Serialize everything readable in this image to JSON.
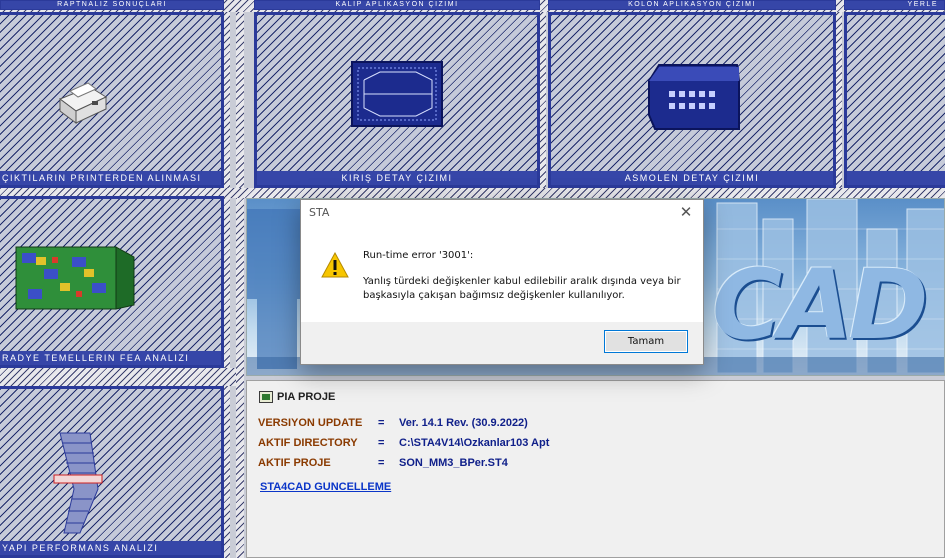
{
  "tiles": {
    "top_captions": [
      "RAPTNALIZ SONUÇLARI",
      "KALIP APLIKASYON ÇIZIMI",
      "KOLON APLIKASYON ÇIZIMI",
      "YERLE"
    ],
    "printer": {
      "caption": "ÇIKTILARIN PRINTERDEN ALINMASI"
    },
    "beam_detail": {
      "caption": "KIRIŞ DETAY ÇIZIMI"
    },
    "column_detail": {
      "caption": "ASMOLEN DETAY ÇIZIMI"
    },
    "raft_fea": {
      "caption": "RADYE TEMELLERIN FEA ANALIZI"
    },
    "performance": {
      "caption": "YAPI PERFORMANS ANALIZI"
    }
  },
  "banner": {
    "logo_text": "CAD"
  },
  "info": {
    "title": "PIA PROJE",
    "rows": [
      {
        "label": "VERSIYON UPDATE",
        "eq": "=",
        "value": "Ver. 14.1  Rev. (30.9.2022)"
      },
      {
        "label": "AKTIF DIRECTORY",
        "eq": "=",
        "value": "C:\\STA4V14\\Ozkanlar103 Apt"
      },
      {
        "label": "AKTIF  PROJE",
        "eq": "=",
        "value": "SON_MM3_BPer.ST4"
      }
    ],
    "link": "STA4CAD GUNCELLEME"
  },
  "dialog": {
    "title": "STA",
    "close_glyph": "✕",
    "heading": "Run-time error '3001':",
    "message": "Yanlış türdeki değişkenler kabul edilebilir aralık dışında veya bir başkasıyla çakışan bağımsız değişkenler kullanılıyor.",
    "ok_label": "Tamam",
    "icon": "warning-icon"
  },
  "colors": {
    "accent": "#3646a8",
    "link": "#0a35c8",
    "label": "#8a3a00",
    "value": "#10208a",
    "button_border": "#0078d7"
  }
}
